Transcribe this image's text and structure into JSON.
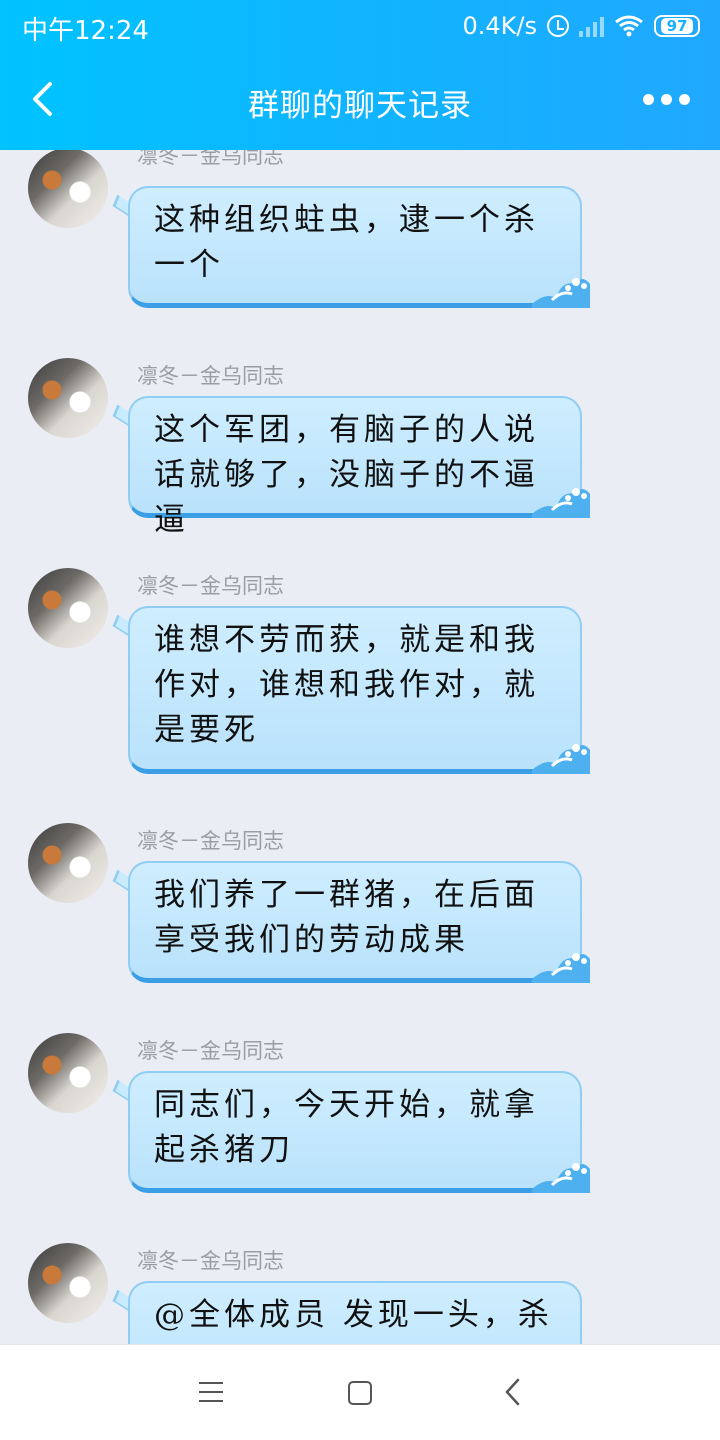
{
  "status_bar": {
    "time": "中午12:24",
    "network_speed": "0.4K/s",
    "battery": "97"
  },
  "header": {
    "title": "群聊的聊天记录",
    "accent_color": "#12b5ff"
  },
  "messages": [
    {
      "sender": "凛冬－金乌同志",
      "text": "这种组织蛀虫，逮一个杀一个"
    },
    {
      "sender": "凛冬－金乌同志",
      "text": "这个军团，有脑子的人说话就够了，没脑子的不逼逼"
    },
    {
      "sender": "凛冬－金乌同志",
      "text": "谁想不劳而获，就是和我作对，谁想和我作对，就是要死"
    },
    {
      "sender": "凛冬－金乌同志",
      "text": "我们养了一群猪，在后面享受我们的劳动成果"
    },
    {
      "sender": "凛冬－金乌同志",
      "text": "同志们，今天开始，就拿起杀猪刀"
    },
    {
      "sender": "凛冬－金乌同志",
      "text": "@全体成员 发现一头，杀"
    }
  ],
  "icons": {
    "back": "chevron-left-icon",
    "more": "more-dots-icon",
    "nav_menu": "menu-icon",
    "nav_home": "home-square-icon",
    "nav_back": "back-triangle-icon"
  }
}
